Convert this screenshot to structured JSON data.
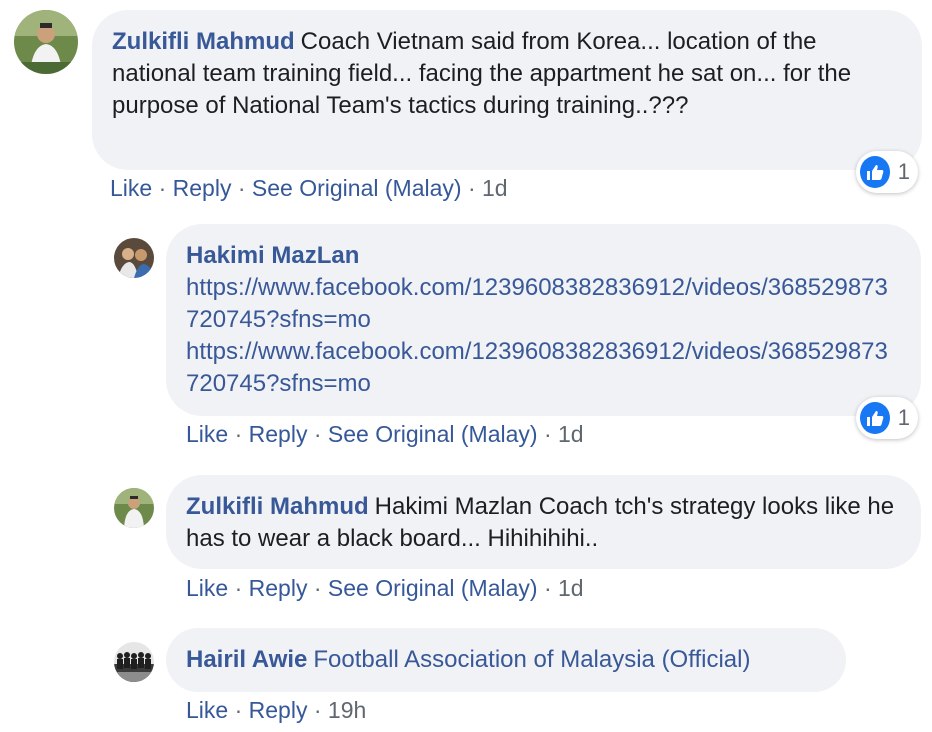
{
  "comments": [
    {
      "author": "Zulkifli Mahmud",
      "text": "Coach Vietnam said from Korea... location of the national team training field... facing the appartment he sat on... for the purpose of National Team's tactics during training..???",
      "actions": {
        "like": "Like",
        "reply": "Reply",
        "see_original": "See Original (Malay)",
        "time": "1d"
      },
      "reaction_count": "1",
      "replies": [
        {
          "author": "Hakimi MazLan",
          "links": [
            "https://www.facebook.com/1239608382836912/videos/368529873720745?sfns=mo",
            "https://www.facebook.com/1239608382836912/videos/368529873720745?sfns=mo"
          ],
          "actions": {
            "like": "Like",
            "reply": "Reply",
            "see_original": "See Original (Malay)",
            "time": "1d"
          },
          "reaction_count": "1"
        },
        {
          "author": "Zulkifli Mahmud",
          "text": "Hakimi Mazlan Coach tch's strategy looks like he has to wear a black board... Hihihihihi..",
          "actions": {
            "like": "Like",
            "reply": "Reply",
            "see_original": "See Original (Malay)",
            "time": "1d"
          }
        },
        {
          "author": "Hairil Awie",
          "text": "Football Association of Malaysia (Official)",
          "actions": {
            "like": "Like",
            "reply": "Reply",
            "time": "19h"
          }
        }
      ]
    }
  ],
  "separator": " · ",
  "icons": {
    "reaction": "thumbs-up-icon"
  },
  "colors": {
    "author": "#385898",
    "bubble": "#f0f2f5",
    "like_badge": "#1877f2",
    "meta": "#606770"
  }
}
